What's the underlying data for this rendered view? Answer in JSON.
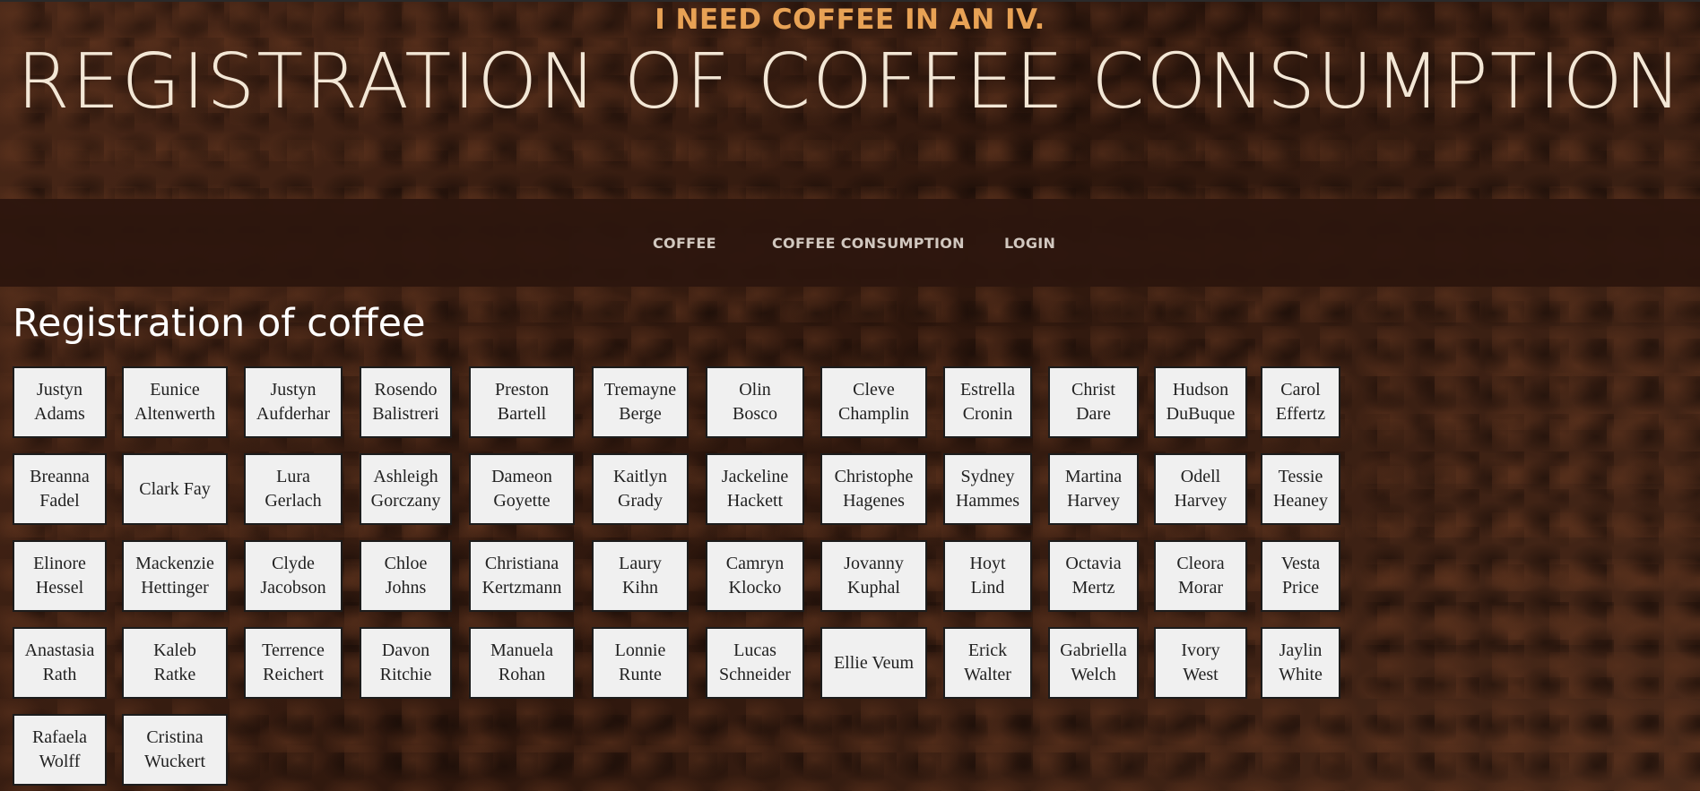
{
  "header": {
    "tagline": "I NEED COFFEE IN AN IV.",
    "title": "REGISTRATION OF COFFEE CONSUMPTION"
  },
  "nav": {
    "items": [
      {
        "label": "COFFEE"
      },
      {
        "label": "COFFEE CONSUMPTION"
      },
      {
        "label": "LOGIN"
      }
    ]
  },
  "main": {
    "heading": "Registration of coffee",
    "people": [
      [
        "Justyn",
        "Adams"
      ],
      [
        "Eunice",
        "Altenwerth"
      ],
      [
        "Justyn",
        "Aufderhar"
      ],
      [
        "Rosendo",
        "Balistreri"
      ],
      [
        "Preston",
        "Bartell"
      ],
      [
        "Tremayne",
        "Berge"
      ],
      [
        "Olin",
        "Bosco"
      ],
      [
        "Cleve",
        "Champlin"
      ],
      [
        "Estrella",
        "Cronin"
      ],
      [
        "Christ",
        "Dare"
      ],
      [
        "Hudson",
        "DuBuque"
      ],
      [
        "Carol",
        "Effertz"
      ],
      [
        "Breanna",
        "Fadel"
      ],
      [
        "Clark Fay",
        ""
      ],
      [
        "Lura",
        "Gerlach"
      ],
      [
        "Ashleigh",
        "Gorczany"
      ],
      [
        "Dameon",
        "Goyette"
      ],
      [
        "Kaitlyn",
        "Grady"
      ],
      [
        "Jackeline",
        "Hackett"
      ],
      [
        "Christophe",
        "Hagenes"
      ],
      [
        "Sydney",
        "Hammes"
      ],
      [
        "Martina",
        "Harvey"
      ],
      [
        "Odell",
        "Harvey"
      ],
      [
        "Tessie",
        "Heaney"
      ],
      [
        "Elinore",
        "Hessel"
      ],
      [
        "Mackenzie",
        "Hettinger"
      ],
      [
        "Clyde",
        "Jacobson"
      ],
      [
        "Chloe",
        "Johns"
      ],
      [
        "Christiana",
        "Kertzmann"
      ],
      [
        "Laury",
        "Kihn"
      ],
      [
        "Camryn",
        "Klocko"
      ],
      [
        "Jovanny",
        "Kuphal"
      ],
      [
        "Hoyt",
        "Lind"
      ],
      [
        "Octavia",
        "Mertz"
      ],
      [
        "Cleora",
        "Morar"
      ],
      [
        "Vesta",
        "Price"
      ],
      [
        "Anastasia",
        "Rath"
      ],
      [
        "Kaleb",
        "Ratke"
      ],
      [
        "Terrence",
        "Reichert"
      ],
      [
        "Davon",
        "Ritchie"
      ],
      [
        "Manuela",
        "Rohan"
      ],
      [
        "Lonnie",
        "Runte"
      ],
      [
        "Lucas",
        "Schneider"
      ],
      [
        "Ellie Veum",
        ""
      ],
      [
        "Erick",
        "Walter"
      ],
      [
        "Gabriella",
        "Welch"
      ],
      [
        "Ivory",
        "West"
      ],
      [
        "Jaylin",
        "White"
      ],
      [
        "Rafaela",
        "Wolff"
      ],
      [
        "Cristina",
        "Wuckert"
      ]
    ]
  },
  "colors": {
    "tagline": "#e8a255",
    "title": "#f3e7d6",
    "nav_bg": "#2d160e",
    "tile_bg": "#f0f0f0"
  }
}
